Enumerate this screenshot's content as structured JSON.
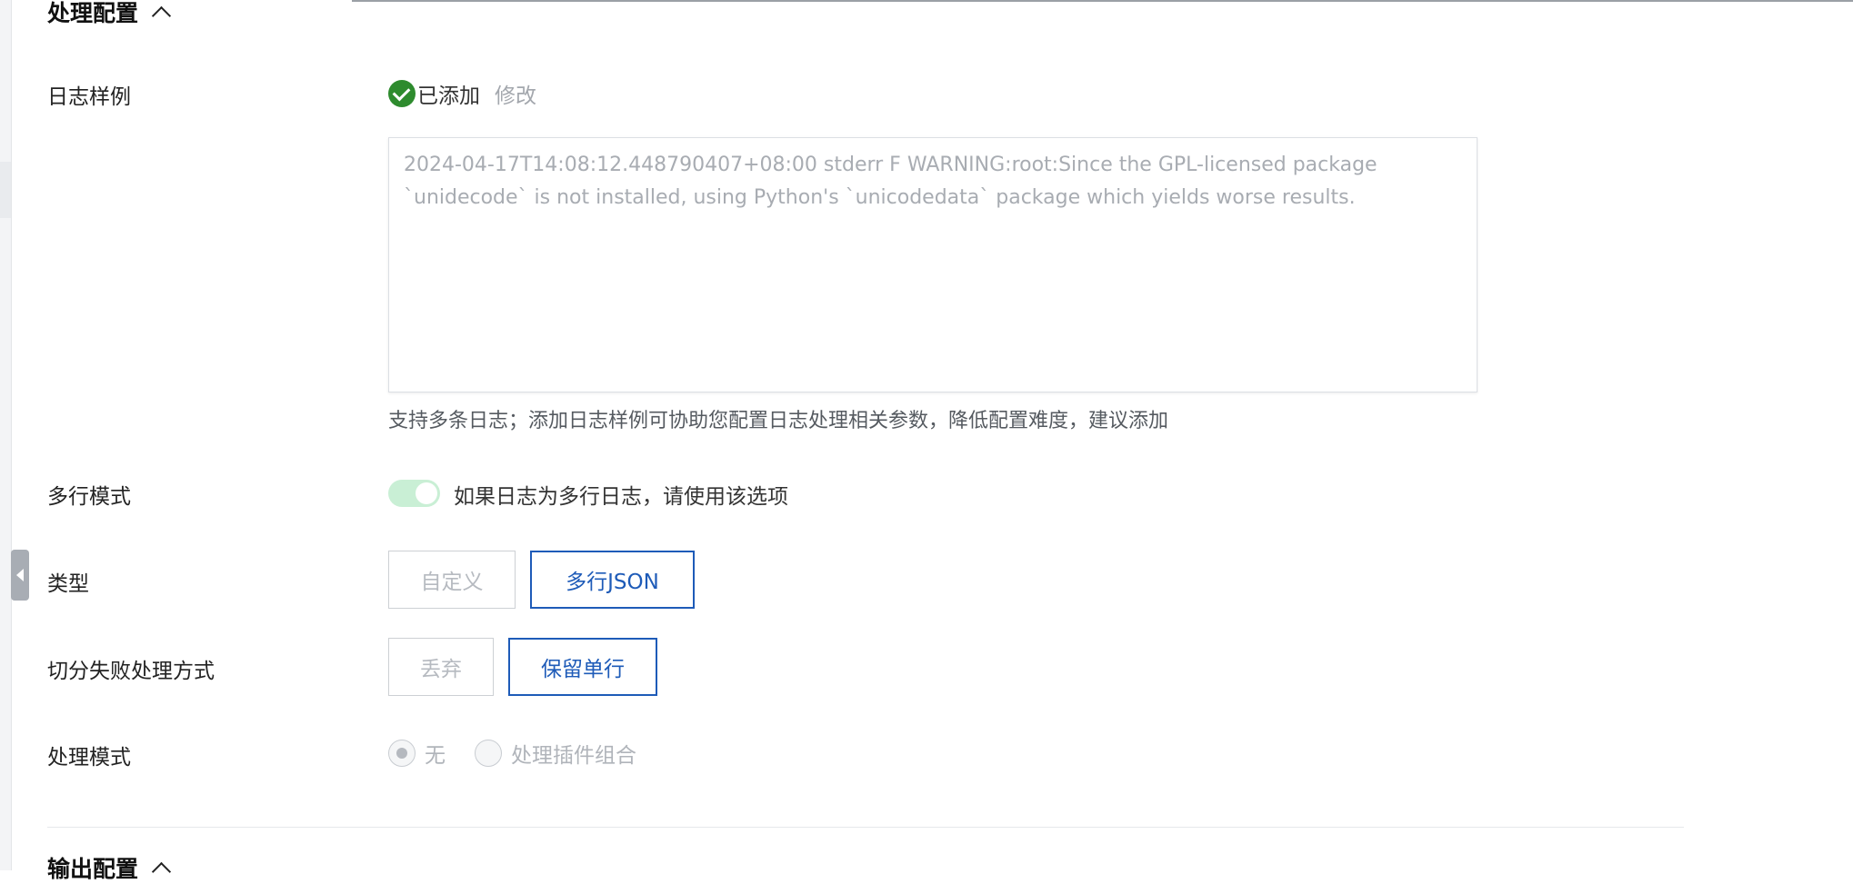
{
  "processing_section": {
    "title": "处理配置"
  },
  "log_sample": {
    "label": "日志样例",
    "status": "已添加",
    "modify_label": "修改",
    "placeholder": "2024-04-17T14:08:12.448790407+08:00 stderr F WARNING:root:Since the GPL-licensed package `unidecode` is not installed, using Python's `unicodedata` package which yields worse results.",
    "hint": "支持多条日志；添加日志样例可协助您配置日志处理相关参数，降低配置难度，建议添加"
  },
  "multiline_mode": {
    "label": "多行模式",
    "enabled": true,
    "description": "如果日志为多行日志，请使用该选项"
  },
  "type": {
    "label": "类型",
    "options": [
      "自定义",
      "多行JSON"
    ],
    "selected": "多行JSON"
  },
  "split_failure": {
    "label": "切分失败处理方式",
    "options": [
      "丢弃",
      "保留单行"
    ],
    "selected": "保留单行"
  },
  "processing_mode": {
    "label": "处理模式",
    "options": [
      "无",
      "处理插件组合"
    ],
    "selected": "无"
  },
  "output_section": {
    "title": "输出配置"
  },
  "colors": {
    "accent": "#1e5bb8",
    "success": "#2e8b2e",
    "toggle_bg": "#c9efd5"
  }
}
